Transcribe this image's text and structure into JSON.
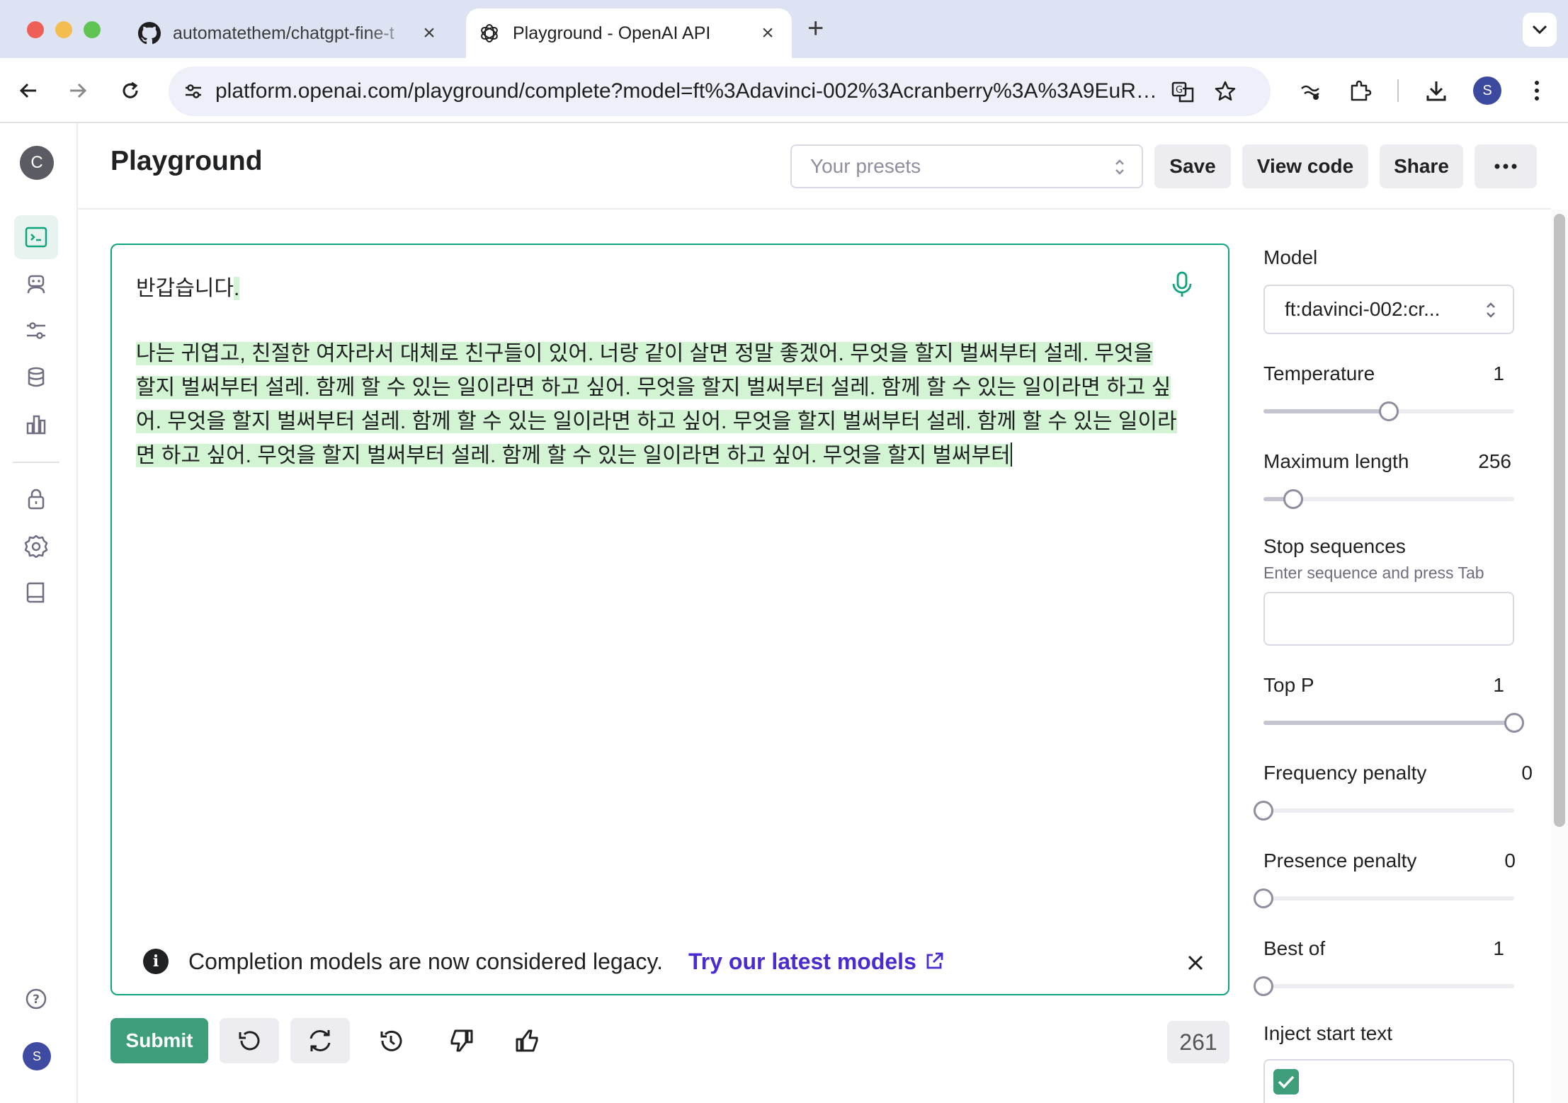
{
  "browser": {
    "tabs": [
      {
        "title": "automatethem/chatgpt-fine-t",
        "icon": "github-icon"
      },
      {
        "title": "Playground - OpenAI API",
        "icon": "openai-icon",
        "active": true
      }
    ],
    "url": "platform.openai.com/playground/complete?model=ft%3Adavinci-002%3Acranberry%3A%3A9EuRh...",
    "profile_initial": "S"
  },
  "app": {
    "org_initial": "C",
    "user_initial": "S",
    "page_title": "Playground",
    "presets_placeholder": "Your presets",
    "save_label": "Save",
    "view_code_label": "View code",
    "share_label": "Share",
    "more_label": "•••"
  },
  "editor": {
    "prompt": "반갑습니다",
    "prompt_suffix": ".",
    "completion": "나는 귀엽고, 친절한 여자라서 대체로 친구들이 있어. 너랑 같이 살면 정말 좋겠어. 무엇을 할지 벌써부터 설레. 무엇을 할지 벌써부터 설레. 함께 할 수 있는 일이라면 하고 싶어. 무엇을 할지 벌써부터 설레. 함께 할 수 있는 일이라면 하고 싶어. 무엇을 할지 벌써부터 설레. 함께 할 수 있는 일이라면 하고 싶어. 무엇을 할지 벌써부터 설레. 함께 할 수 있는 일이라면 하고 싶어. 무엇을 할지 벌써부터 설레. 함께 할 수 있는 일이라면 하고 싶어. 무엇을 할지 벌써부터",
    "notice_text": "Completion models are now considered legacy.",
    "notice_link": "Try our latest models"
  },
  "actions": {
    "submit_label": "Submit",
    "token_count": "261"
  },
  "settings": {
    "model_label": "Model",
    "model_value": "ft:davinci-002:cr...",
    "temperature": {
      "label": "Temperature",
      "value": "1",
      "fraction": 0.5
    },
    "max_length": {
      "label": "Maximum length",
      "value": "256",
      "fraction": 0.12
    },
    "stop_sequences": {
      "label": "Stop sequences",
      "hint": "Enter sequence and press Tab"
    },
    "top_p": {
      "label": "Top P",
      "value": "1",
      "fraction": 1.0
    },
    "frequency_penalty": {
      "label": "Frequency penalty",
      "value": "0",
      "fraction": 0.0
    },
    "presence_penalty": {
      "label": "Presence penalty",
      "value": "0",
      "fraction": 0.0
    },
    "best_of": {
      "label": "Best of",
      "value": "1",
      "fraction": 0.0
    },
    "inject_start_text": {
      "label": "Inject start text",
      "checked": true
    }
  },
  "colors": {
    "accent": "#10a37f",
    "submit": "#3e9e7a",
    "highlight": "#d2f4d3",
    "link": "#4a2bd1"
  }
}
